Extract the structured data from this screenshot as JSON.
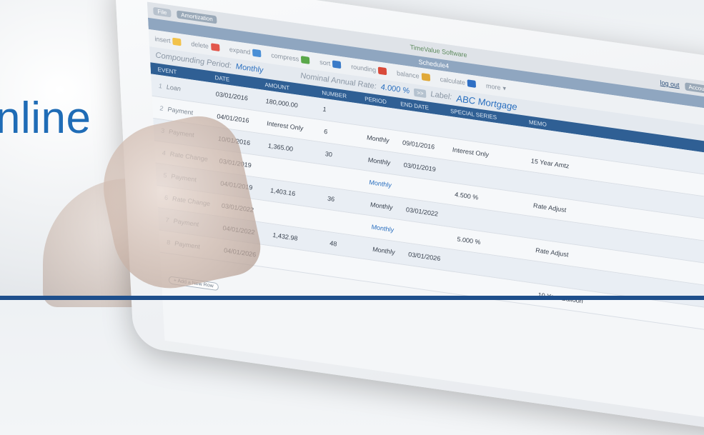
{
  "headline": "nline",
  "app": {
    "brand": "TimeValue Software",
    "menu": [
      "File",
      "Amortization"
    ],
    "logout_label": "log out",
    "account_label": "Account",
    "schedule_label": "Schedule4",
    "toolbar": [
      {
        "label": "insert",
        "icon": "insert-icon"
      },
      {
        "label": "delete",
        "icon": "delete-icon"
      },
      {
        "label": "expand",
        "icon": "expand-icon"
      },
      {
        "label": "compress",
        "icon": "compress-icon"
      },
      {
        "label": "sort",
        "icon": "sort-icon"
      },
      {
        "label": "rounding",
        "icon": "rounding-icon"
      },
      {
        "label": "balance",
        "icon": "balance-icon"
      },
      {
        "label": "calculate",
        "icon": "calculate-icon"
      },
      {
        "label": "more",
        "icon": "more-icon"
      }
    ],
    "compounding_label": "Compounding Period:",
    "compounding_value": "Monthly",
    "nominal_label": "Nominal Annual Rate:",
    "nominal_value": "4.000 %",
    "label_label": "Label:",
    "label_value": "ABC Mortgage",
    "expand_glyph": ">>",
    "columns": [
      "EVENT",
      "DATE",
      "AMOUNT",
      "NUMBER",
      "PERIOD",
      "END DATE",
      "SPECIAL SERIES",
      "MEMO"
    ],
    "rows": [
      {
        "n": "1",
        "event": "Loan",
        "date": "03/01/2016",
        "amount": "180,000.00",
        "number": "1",
        "period": "",
        "end": "",
        "special": "",
        "memo": ""
      },
      {
        "n": "2",
        "event": "Payment",
        "date": "04/01/2016",
        "amount": "Interest Only",
        "number": "6",
        "period": "Monthly",
        "end": "09/01/2016",
        "special": "Interest Only",
        "memo": "15 Year Amtz"
      },
      {
        "n": "3",
        "event": "Payment",
        "date": "10/01/2016",
        "amount": "1,365.00",
        "number": "30",
        "period": "Monthly",
        "end": "03/01/2019",
        "special": "",
        "memo": ""
      },
      {
        "n": "4",
        "event": "Rate Change",
        "date": "03/01/2019",
        "amount": "",
        "number": "",
        "period": "Monthly",
        "end": "",
        "special": "4.500 %",
        "memo": "Rate Adjust"
      },
      {
        "n": "5",
        "event": "Payment",
        "date": "04/01/2019",
        "amount": "1,403.16",
        "number": "36",
        "period": "Monthly",
        "end": "03/01/2022",
        "special": "",
        "memo": ""
      },
      {
        "n": "6",
        "event": "Rate Change",
        "date": "03/01/2022",
        "amount": "",
        "number": "",
        "period": "Monthly",
        "end": "",
        "special": "5.000 %",
        "memo": "Rate Adjust"
      },
      {
        "n": "7",
        "event": "Payment",
        "date": "04/01/2022",
        "amount": "1,432.98",
        "number": "48",
        "period": "Monthly",
        "end": "03/01/2026",
        "special": "",
        "memo": ""
      },
      {
        "n": "8",
        "event": "Payment",
        "date": "04/01/2026",
        "amount": "",
        "number": "",
        "period": "",
        "end": "",
        "special": "",
        "memo": "10 Year Balloon"
      }
    ],
    "add_row_label": "+ Add a New Row"
  }
}
